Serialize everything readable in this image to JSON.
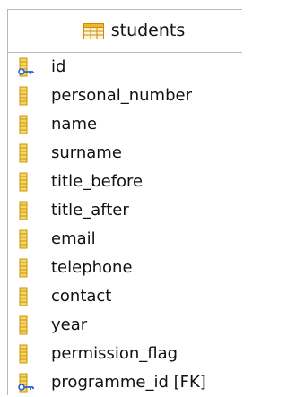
{
  "table": {
    "name": "students",
    "icon": "table-icon"
  },
  "columns": [
    {
      "label": "id",
      "icon": "primary-key-icon"
    },
    {
      "label": "personal_number",
      "icon": "column-icon"
    },
    {
      "label": "name",
      "icon": "column-icon"
    },
    {
      "label": "surname",
      "icon": "column-icon"
    },
    {
      "label": "title_before",
      "icon": "column-icon"
    },
    {
      "label": "title_after",
      "icon": "column-icon"
    },
    {
      "label": "email",
      "icon": "column-icon"
    },
    {
      "label": "telephone",
      "icon": "column-icon"
    },
    {
      "label": "contact",
      "icon": "column-icon"
    },
    {
      "label": "year",
      "icon": "column-icon"
    },
    {
      "label": "permission_flag",
      "icon": "column-icon"
    },
    {
      "label": "programme_id [FK]",
      "icon": "foreign-key-icon"
    }
  ],
  "colors": {
    "border": "#b8b8b8",
    "column_icon": "#c99700",
    "table_icon": "#d08a00",
    "key_icon": "#2d62d6"
  }
}
